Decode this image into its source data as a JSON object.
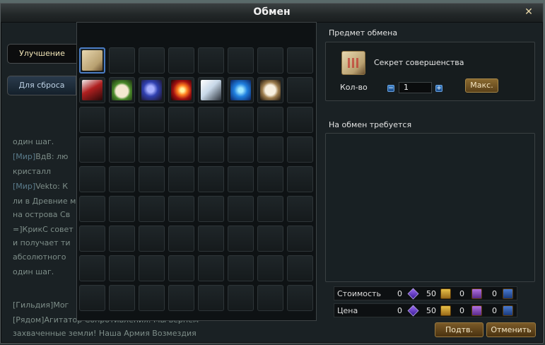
{
  "window": {
    "title": "Обмен",
    "close_icon": "close-icon"
  },
  "tabs": [
    {
      "label": "Улучшение",
      "active": true
    },
    {
      "label": "Для сброса",
      "active": false
    }
  ],
  "background_chat": [
    {
      "tag": "",
      "text": "один шаг."
    },
    {
      "tag": "[Мир]",
      "text": "ВдВ: лю"
    },
    {
      "tag": "",
      "text": "кристалл"
    },
    {
      "tag": "[Мир]",
      "text": "Vekto: К"
    },
    {
      "tag": "",
      "text": "ли в Древние мо"
    },
    {
      "tag": "",
      "text": "на острова Св"
    },
    {
      "tag": "",
      "text": "=]КрикС совет"
    },
    {
      "tag": "",
      "text": "и получает ти"
    },
    {
      "tag": "",
      "text": "абсолютного"
    },
    {
      "tag": "",
      "text": "один шаг."
    },
    {
      "tag": "",
      "text": "[Гильдия]Мог"
    },
    {
      "tag": "",
      "text": "[Рядом]Агитатор Сопротивления: Мы вернем"
    },
    {
      "tag": "",
      "text": "захваченные земли! Наша Армия Возмездия"
    }
  ],
  "inventory": {
    "rows": 9,
    "cols": 8,
    "items": [
      {
        "row": 0,
        "col": 0,
        "icon": "secret-of-perfection-book-icon",
        "selected": true
      },
      {
        "row": 1,
        "col": 0,
        "icon": "blade-icon"
      },
      {
        "row": 1,
        "col": 1,
        "icon": "rice-bowl-icon"
      },
      {
        "row": 1,
        "col": 2,
        "icon": "potion-icon"
      },
      {
        "row": 1,
        "col": 3,
        "icon": "fireball-icon"
      },
      {
        "row": 1,
        "col": 4,
        "icon": "feather-icon"
      },
      {
        "row": 1,
        "col": 5,
        "icon": "blue-spiral-icon"
      },
      {
        "row": 1,
        "col": 6,
        "icon": "emblem-icon"
      }
    ]
  },
  "exchange_item": {
    "section_label": "Предмет обмена",
    "name": "Секрет совершенства",
    "qty_label": "Кол-во",
    "qty_value": "1",
    "minus": "−",
    "plus": "+",
    "max_label": "Макс."
  },
  "required": {
    "section_label": "На обмен требуется"
  },
  "cost_rows": [
    {
      "label": "Стоимость",
      "gem": "0",
      "gold": "50",
      "purple": "0",
      "blue": "0"
    },
    {
      "label": "Цена",
      "gem": "0",
      "gold": "50",
      "purple": "0",
      "blue": "0"
    }
  ],
  "buttons": {
    "confirm": "Подтв.",
    "cancel": "Отменить"
  },
  "colors": {
    "tab_active_text": "#f2e6b8",
    "selected_border": "#4a7cc4",
    "gold_button": "#7a5a28"
  }
}
